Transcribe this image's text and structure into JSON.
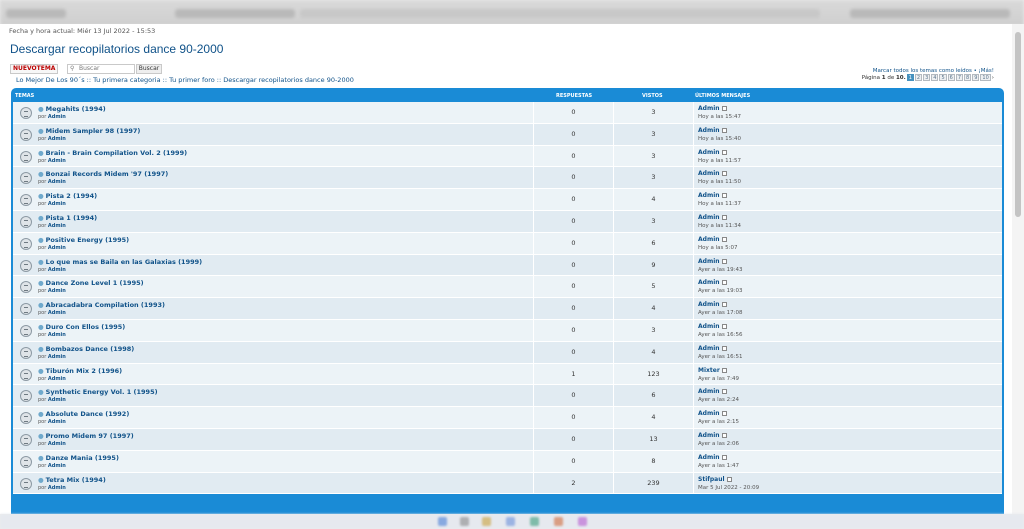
{
  "header": {
    "datetime": "Fecha y hora actual: Miér 13 Jul 2022 - 15:53",
    "title": "Descargar recopilatorios dance 90-2000"
  },
  "toolbar": {
    "new_topic_label": "NUEVOTEMA",
    "search_placeholder": "Buscar",
    "search_button": "Buscar"
  },
  "breadcrumb": "Lo Mejor De Los 90´s :: Tu primera categoria :: Tu primer foro :: Descargar recopilatorios dance 90-2000",
  "mark_read": "Marcar todos los temas como leídos • ¡Más!",
  "pagination": {
    "label_prefix": "Página",
    "current": "1",
    "label_of": "de",
    "total": "10.",
    "pages": [
      "1",
      "2",
      "3",
      "4",
      "5",
      "6",
      "7",
      "8",
      "9",
      "10"
    ],
    "next": "›"
  },
  "table": {
    "headers": {
      "topics": "TEMAS",
      "replies": "RESPUESTAS",
      "views": "VISTOS",
      "last": "ÚLTIMOS MENSAJES"
    },
    "by_label": "por",
    "rows": [
      {
        "title": "Megahits (1994)",
        "author": "Admin",
        "replies": "0",
        "views": "3",
        "last_user": "Admin",
        "last_time": "Hoy a las 15:47"
      },
      {
        "title": "Midem Sampler 98 (1997)",
        "author": "Admin",
        "replies": "0",
        "views": "3",
        "last_user": "Admin",
        "last_time": "Hoy a las 15:40"
      },
      {
        "title": "Brain - Brain Compilation Vol. 2 (1999)",
        "author": "Admin",
        "replies": "0",
        "views": "3",
        "last_user": "Admin",
        "last_time": "Hoy a las 11:57"
      },
      {
        "title": "Bonzai Records Midem '97 (1997)",
        "author": "Admin",
        "replies": "0",
        "views": "3",
        "last_user": "Admin",
        "last_time": "Hoy a las 11:50"
      },
      {
        "title": "Pista 2 (1994)",
        "author": "Admin",
        "replies": "0",
        "views": "4",
        "last_user": "Admin",
        "last_time": "Hoy a las 11:37"
      },
      {
        "title": "Pista 1 (1994)",
        "author": "Admin",
        "replies": "0",
        "views": "3",
        "last_user": "Admin",
        "last_time": "Hoy a las 11:34"
      },
      {
        "title": "Positive Energy (1995)",
        "author": "Admin",
        "replies": "0",
        "views": "6",
        "last_user": "Admin",
        "last_time": "Hoy a las 5:07"
      },
      {
        "title": "Lo que mas se Baila en las Galaxias (1999)",
        "author": "Admin",
        "replies": "0",
        "views": "9",
        "last_user": "Admin",
        "last_time": "Ayer a las 19:43"
      },
      {
        "title": "Dance Zone Level 1 (1995)",
        "author": "Admin",
        "replies": "0",
        "views": "5",
        "last_user": "Admin",
        "last_time": "Ayer a las 19:03"
      },
      {
        "title": "Abracadabra Compilation (1993)",
        "author": "Admin",
        "replies": "0",
        "views": "4",
        "last_user": "Admin",
        "last_time": "Ayer a las 17:08"
      },
      {
        "title": "Duro Con Ellos (1995)",
        "author": "Admin",
        "replies": "0",
        "views": "3",
        "last_user": "Admin",
        "last_time": "Ayer a las 16:56"
      },
      {
        "title": "Bombazos Dance (1998)",
        "author": "Admin",
        "replies": "0",
        "views": "4",
        "last_user": "Admin",
        "last_time": "Ayer a las 16:51"
      },
      {
        "title": "Tiburón Mix 2 (1996)",
        "author": "Admin",
        "replies": "1",
        "views": "123",
        "last_user": "Mixter",
        "last_time": "Ayer a las 7:49"
      },
      {
        "title": "Synthetic Energy Vol. 1 (1995)",
        "author": "Admin",
        "replies": "0",
        "views": "6",
        "last_user": "Admin",
        "last_time": "Ayer a las 2:24"
      },
      {
        "title": "Absolute Dance (1992)",
        "author": "Admin",
        "replies": "0",
        "views": "4",
        "last_user": "Admin",
        "last_time": "Ayer a las 2:15"
      },
      {
        "title": "Promo Midem 97 (1997)",
        "author": "Admin",
        "replies": "0",
        "views": "13",
        "last_user": "Admin",
        "last_time": "Ayer a las 2:06"
      },
      {
        "title": "Danze Mania (1995)",
        "author": "Admin",
        "replies": "0",
        "views": "8",
        "last_user": "Admin",
        "last_time": "Ayer a las 1:47"
      },
      {
        "title": "Tetra Mix (1994)",
        "author": "Admin",
        "replies": "2",
        "views": "239",
        "last_user": "Stifpaul",
        "last_time": "Mar 5 Jul 2022 - 20:09"
      }
    ]
  },
  "colors": {
    "accent": "#1a8bd6",
    "link": "#105289",
    "row_light": "#ecf3f7",
    "row_dark": "#e1ebf2"
  },
  "icons": {
    "topic": "topic-read-icon",
    "goto_last": "goto-last-post-icon",
    "search": "search-icon"
  }
}
